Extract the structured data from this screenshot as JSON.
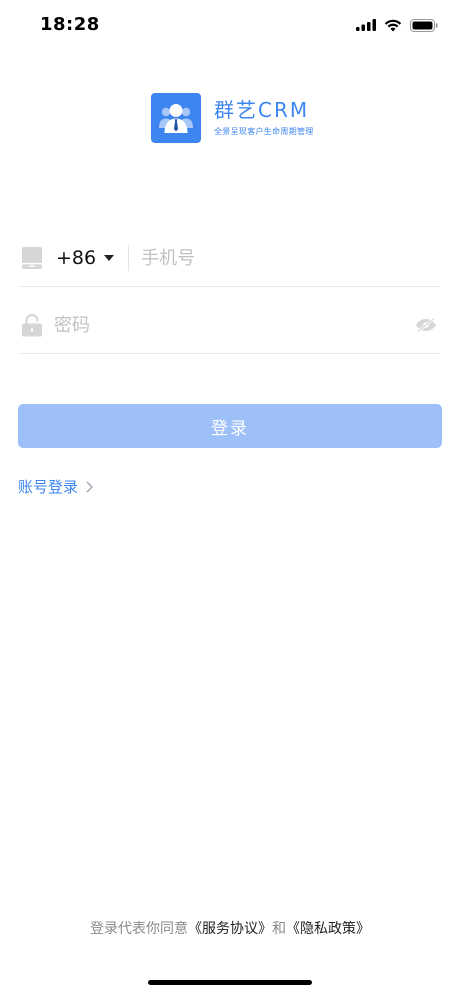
{
  "status_bar": {
    "time": "18:28",
    "signal_icon": "signal-bars-icon",
    "wifi_icon": "wifi-icon",
    "battery_icon": "battery-icon"
  },
  "logo": {
    "title": "群艺CRM",
    "slogan": "全景呈现客户生命周期管理",
    "icon": "user-avatar-icon",
    "color": "#3D86F0"
  },
  "form": {
    "phone": {
      "icon": "phone-icon",
      "country_code": "+86",
      "placeholder": "手机号",
      "value": ""
    },
    "password": {
      "icon": "lock-icon",
      "placeholder": "密码",
      "value": "",
      "toggle_icon": "eye-off-icon"
    }
  },
  "login_button": {
    "label": "登录",
    "color": "#9CC0F7"
  },
  "account_login": {
    "label": "账号登录",
    "icon": "chevron-right-icon"
  },
  "agreement": {
    "prefix": "登录代表你同意",
    "service_link": "《服务协议》",
    "conjunction": "和",
    "privacy_link": "《隐私政策》"
  }
}
